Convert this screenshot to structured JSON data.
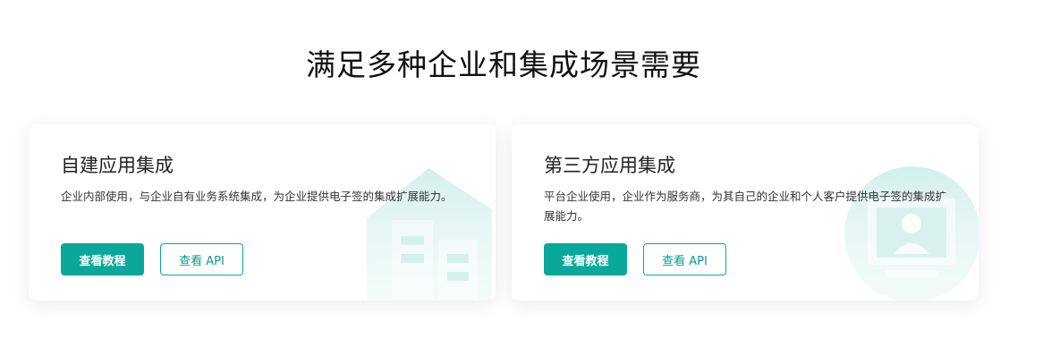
{
  "section": {
    "title": "满足多种企业和集成场景需要"
  },
  "cards": [
    {
      "title": "自建应用集成",
      "description": "企业内部使用，与企业自有业务系统集成，为企业提供电子签的集成扩展能力。",
      "primary_button": "查看教程",
      "secondary_button": "查看 API",
      "illustration": "building-icon"
    },
    {
      "title": "第三方应用集成",
      "description": "平台企业使用，企业作为服务商，为其自己的企业和个人客户提供电子签的集成扩展能力。",
      "primary_button": "查看教程",
      "secondary_button": "查看 API",
      "illustration": "profile-screen-icon"
    }
  ],
  "colors": {
    "accent": "#0aa89a",
    "illustration": "#d8f1ee"
  }
}
